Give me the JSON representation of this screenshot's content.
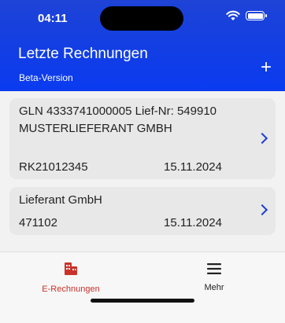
{
  "status_bar": {
    "time": "04:11"
  },
  "header": {
    "title": "Letzte Rechnungen",
    "subtitle": "Beta-Version",
    "add_icon": "plus-icon"
  },
  "invoices": [
    {
      "supplier": "GLN 4333741000005 Lief-Nr: 549910 MUSTERLIEFERANT GMBH",
      "reference": "RK21012345",
      "date": "15.11.2024"
    },
    {
      "supplier": "Lieferant GmbH",
      "reference": "471102",
      "date": "15.11.2024"
    }
  ],
  "tabbar": {
    "tabs": [
      {
        "label": "E-Rechnungen",
        "icon": "invoice-icon",
        "active": true
      },
      {
        "label": "Mehr",
        "icon": "menu-icon",
        "active": false
      }
    ]
  },
  "colors": {
    "header_blue": "#123ee4",
    "active_tab": "#c8322a",
    "chevron": "#1e3fcf"
  }
}
